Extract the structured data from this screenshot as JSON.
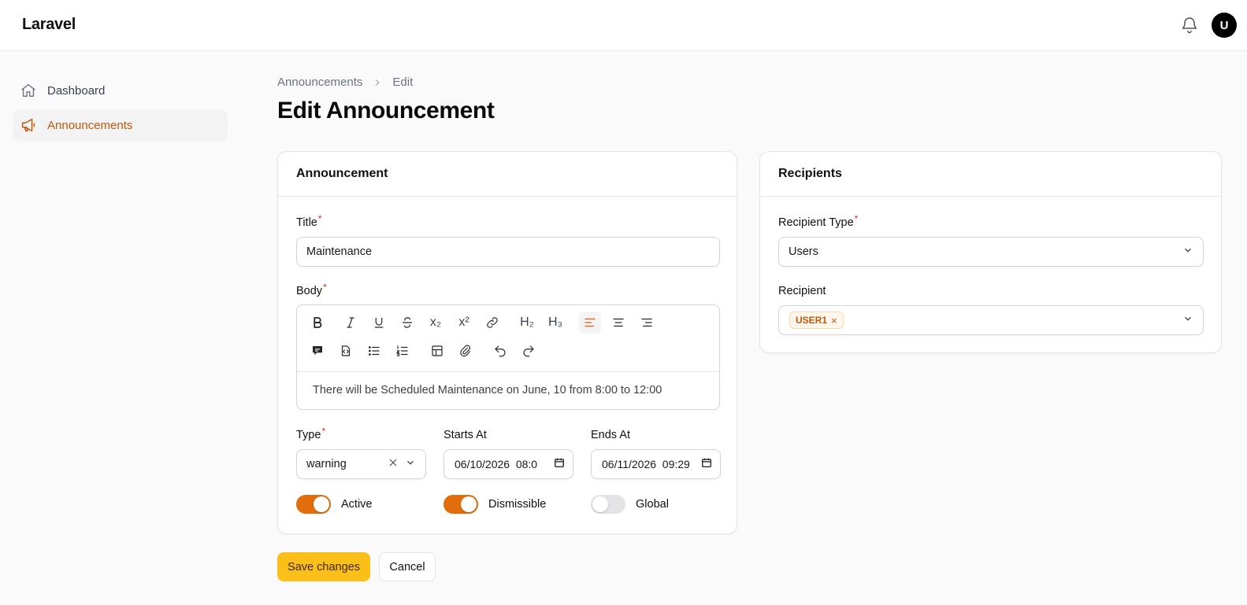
{
  "app": {
    "brand": "Laravel",
    "user_initial": "U"
  },
  "sidebar": {
    "items": [
      {
        "label": "Dashboard",
        "icon": "home-icon",
        "active": false
      },
      {
        "label": "Announcements",
        "icon": "megaphone-icon",
        "active": true
      }
    ]
  },
  "breadcrumb": {
    "parent": "Announcements",
    "current": "Edit"
  },
  "page": {
    "title": "Edit Announcement"
  },
  "announcement": {
    "heading": "Announcement",
    "title_label": "Title",
    "title_value": "Maintenance",
    "body_label": "Body",
    "body_text": "There will be Scheduled Maintenance on June, 10 from 8:00 to 12:00",
    "toolbar_row1": [
      "bold-icon",
      "italic-icon",
      "underline-icon",
      "strike-icon",
      "subscript-icon",
      "superscript-icon",
      "link-icon",
      "h2-icon",
      "h3-icon",
      "align-left-icon",
      "align-center-icon",
      "align-right-icon"
    ],
    "toolbar_row2": [
      "blockquote-icon",
      "code-block-icon",
      "bullet-list-icon",
      "ordered-list-icon",
      "table-icon",
      "attach-icon",
      "undo-icon",
      "redo-icon"
    ],
    "h2_text": "H₂",
    "h3_text": "H₃",
    "sub_text": "x₂",
    "sup_text": "x²",
    "type_label": "Type",
    "type_value": "warning",
    "starts_label": "Starts At",
    "starts_value": "06/10/2026  08:0",
    "ends_label": "Ends At",
    "ends_value": "06/11/2026  09:29",
    "toggles": [
      {
        "label": "Active",
        "on": true
      },
      {
        "label": "Dismissible",
        "on": true
      },
      {
        "label": "Global",
        "on": false
      }
    ]
  },
  "recipients": {
    "heading": "Recipients",
    "type_label": "Recipient Type",
    "type_value": "Users",
    "recipient_label": "Recipient",
    "tags": [
      "USER1"
    ]
  },
  "actions": {
    "save_label": "Save changes",
    "cancel_label": "Cancel"
  },
  "colors": {
    "accent": "#e26d0c",
    "primary_button": "#fbbf1a",
    "required": "#dc2626"
  }
}
